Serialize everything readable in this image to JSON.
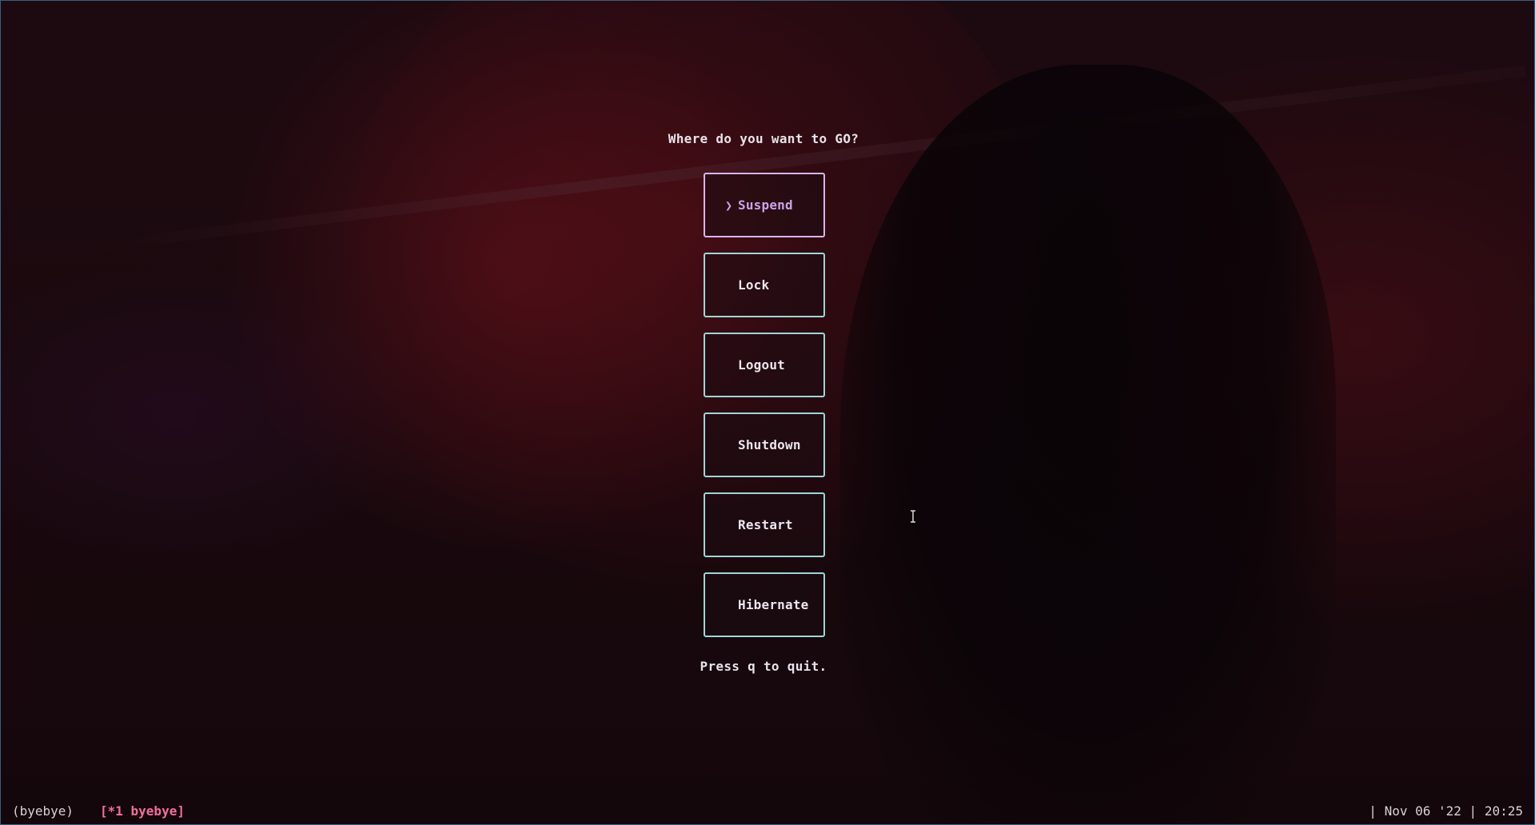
{
  "prompt": "Where do you want to GO?",
  "menu": {
    "selected_marker": "❯",
    "options": [
      {
        "label": "Suspend",
        "selected": true
      },
      {
        "label": "Lock",
        "selected": false
      },
      {
        "label": "Logout",
        "selected": false
      },
      {
        "label": "Shutdown",
        "selected": false
      },
      {
        "label": "Restart",
        "selected": false
      },
      {
        "label": "Hibernate",
        "selected": false
      }
    ]
  },
  "hint": "Press q to quit.",
  "statusbar": {
    "session": "(byebye)",
    "window": "[*1 byebye]",
    "date": "Nov 06 '22",
    "time": "20:25",
    "separator": "|"
  },
  "colors": {
    "border": "#9ed6d8",
    "selected_border": "#d6b6ea",
    "selected_text": "#c9a4ea",
    "active_window": "#f0709a",
    "window_frame": "#3b5f7d"
  },
  "icons": {
    "cursor": "text-cursor-icon",
    "selection": "chevron-right-icon"
  }
}
